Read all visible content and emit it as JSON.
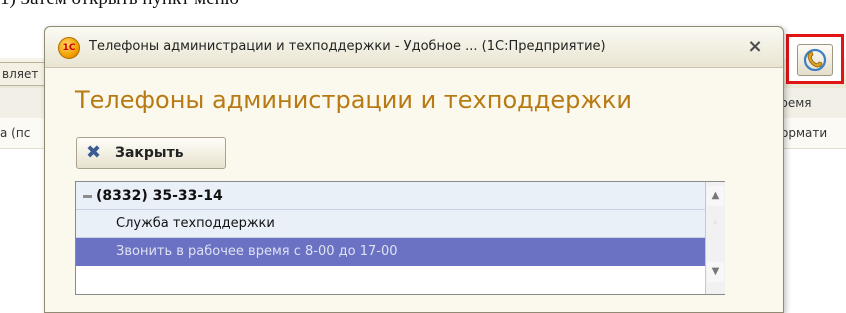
{
  "page": {
    "top_text": "1) Затем открыть пункт меню"
  },
  "background_app": {
    "tab_left": "вляет",
    "row1_left": "",
    "row1_mid": "",
    "row2_left": "а (пс",
    "col_vremya": "Время",
    "col_normat": "Нормати"
  },
  "phone_button": {
    "icon": "phone-support-icon",
    "highlight_color": "#e11414"
  },
  "dialog": {
    "title": "Телефоны администрации и техподдержки - Удобное ... (1С:Предприятие)",
    "app_icon_text": "1С",
    "close_glyph": "×",
    "heading": "Телефоны администрации и техподдержки",
    "heading_color": "#b87a13",
    "close_button_label": "Закрыть",
    "tree": [
      {
        "text": "(8332) 35-33-14",
        "level": 0,
        "expanded": true,
        "selected": false
      },
      {
        "text": "Служба техподдержки",
        "level": 1,
        "selected": false
      },
      {
        "text": "Звонить в рабочее время с 8-00 до 17-00",
        "level": 1,
        "selected": true
      }
    ],
    "selection_color": "#6b72c4"
  }
}
